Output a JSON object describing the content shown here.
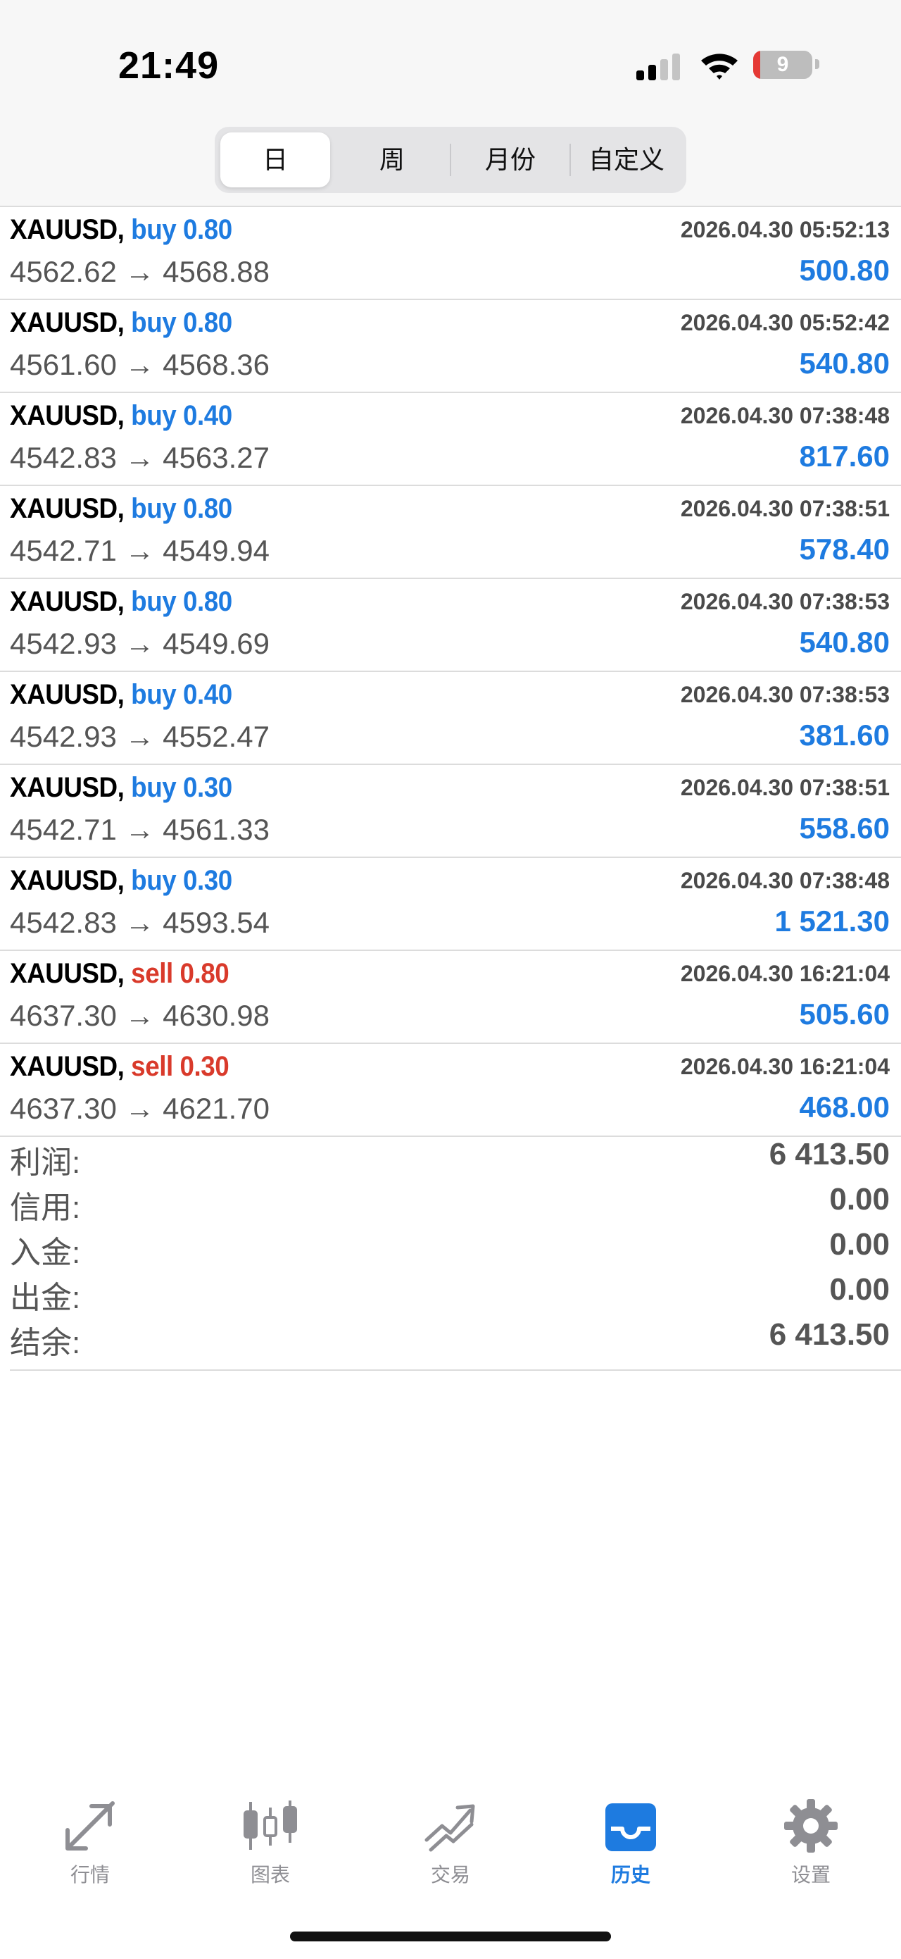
{
  "status_bar": {
    "time": "21:49",
    "battery": "9",
    "battery_level_percent": 9,
    "battery_color": "#e53935"
  },
  "period_tabs": [
    {
      "label": "日",
      "selected": true
    },
    {
      "label": "周",
      "selected": false
    },
    {
      "label": "月份",
      "selected": false
    },
    {
      "label": "自定义",
      "selected": false
    }
  ],
  "colors": {
    "buy": "#1e7be0",
    "sell": "#d93a2b",
    "profit": "#1e7be0"
  },
  "trades": [
    {
      "symbol": "XAUUSD,",
      "side": "buy 0.80",
      "type": "buy",
      "datetime": "2026.04.30 05:52:13",
      "prices": "4562.62 → 4568.88",
      "profit": "500.80"
    },
    {
      "symbol": "XAUUSD,",
      "side": "buy 0.80",
      "type": "buy",
      "datetime": "2026.04.30 05:52:42",
      "prices": "4561.60 → 4568.36",
      "profit": "540.80"
    },
    {
      "symbol": "XAUUSD,",
      "side": "buy 0.40",
      "type": "buy",
      "datetime": "2026.04.30 07:38:48",
      "prices": "4542.83 → 4563.27",
      "profit": "817.60"
    },
    {
      "symbol": "XAUUSD,",
      "side": "buy 0.80",
      "type": "buy",
      "datetime": "2026.04.30 07:38:51",
      "prices": "4542.71 → 4549.94",
      "profit": "578.40"
    },
    {
      "symbol": "XAUUSD,",
      "side": "buy 0.80",
      "type": "buy",
      "datetime": "2026.04.30 07:38:53",
      "prices": "4542.93 → 4549.69",
      "profit": "540.80"
    },
    {
      "symbol": "XAUUSD,",
      "side": "buy 0.40",
      "type": "buy",
      "datetime": "2026.04.30 07:38:53",
      "prices": "4542.93 → 4552.47",
      "profit": "381.60"
    },
    {
      "symbol": "XAUUSD,",
      "side": "buy 0.30",
      "type": "buy",
      "datetime": "2026.04.30 07:38:51",
      "prices": "4542.71 → 4561.33",
      "profit": "558.60"
    },
    {
      "symbol": "XAUUSD,",
      "side": "buy 0.30",
      "type": "buy",
      "datetime": "2026.04.30 07:38:48",
      "prices": "4542.83 → 4593.54",
      "profit": "1 521.30"
    },
    {
      "symbol": "XAUUSD,",
      "side": "sell 0.80",
      "type": "sell",
      "datetime": "2026.04.30 16:21:04",
      "prices": "4637.30 → 4630.98",
      "profit": "505.60"
    },
    {
      "symbol": "XAUUSD,",
      "side": "sell 0.30",
      "type": "sell",
      "datetime": "2026.04.30 16:21:04",
      "prices": "4637.30 → 4621.70",
      "profit": "468.00"
    }
  ],
  "summary": [
    {
      "label": "利润:",
      "value": "6 413.50"
    },
    {
      "label": "信用:",
      "value": "0.00"
    },
    {
      "label": "入金:",
      "value": "0.00"
    },
    {
      "label": "出金:",
      "value": "0.00"
    },
    {
      "label": "结余:",
      "value": "6 413.50"
    }
  ],
  "tabbar": [
    {
      "label": "行情",
      "icon": "quotes-arrows-icon",
      "active": false
    },
    {
      "label": "图表",
      "icon": "candlestick-chart-icon",
      "active": false
    },
    {
      "label": "交易",
      "icon": "trade-chart-icon",
      "active": false
    },
    {
      "label": "历史",
      "icon": "history-inbox-icon",
      "active": true
    },
    {
      "label": "设置",
      "icon": "gear-icon",
      "active": false
    }
  ]
}
